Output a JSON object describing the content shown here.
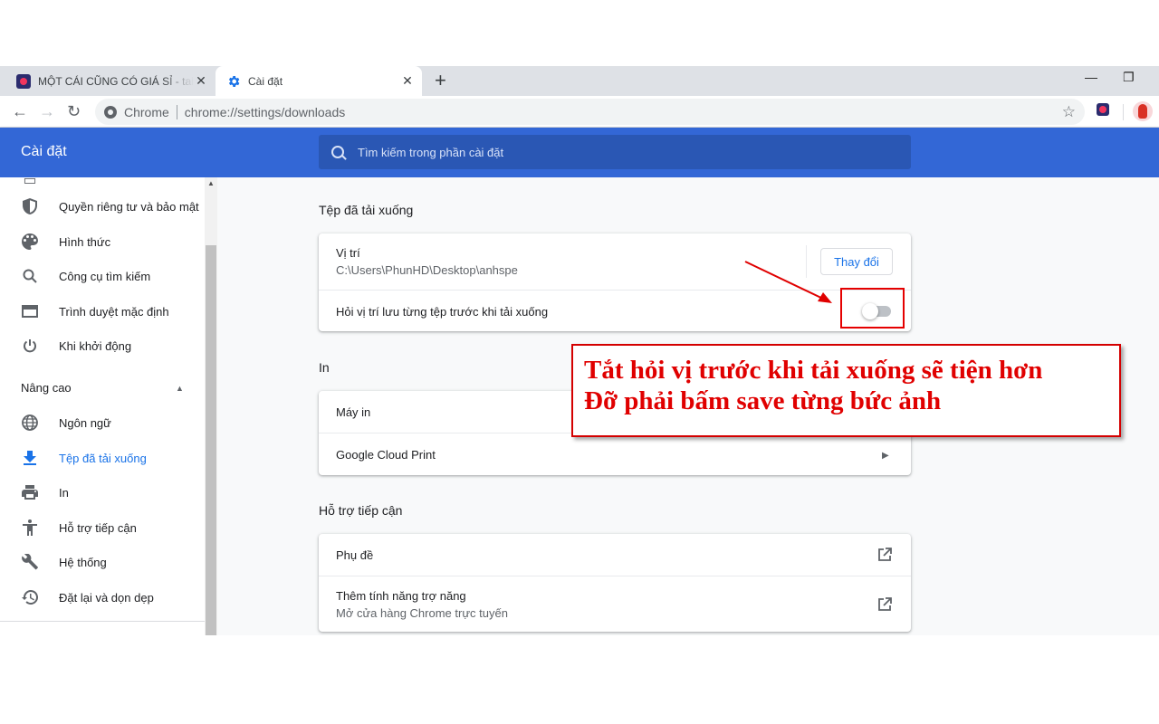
{
  "browser": {
    "tabs": [
      {
        "title": "MỘT CÁI CŨNG CÓ GIÁ SỈ - tai nghe",
        "close": "✕",
        "active": false
      },
      {
        "title": "Cài đặt",
        "close": "✕",
        "active": true
      }
    ],
    "new_tab": "+",
    "window_controls": {
      "minimize": "—",
      "restore": "❐"
    },
    "omnibox": {
      "chip": "Chrome",
      "url": "chrome://settings/downloads"
    },
    "icons": [
      "back-icon",
      "forward-icon",
      "reload-icon",
      "star-icon",
      "extension-icon",
      "profile-avatar"
    ]
  },
  "header": {
    "title": "Cài đặt",
    "search_placeholder": "Tìm kiếm trong phần cài đặt"
  },
  "sidebar": {
    "items": [
      {
        "label": "Quyền riêng tư và bảo mật",
        "icon": "shield-icon"
      },
      {
        "label": "Hình thức",
        "icon": "palette-icon"
      },
      {
        "label": "Công cụ tìm kiếm",
        "icon": "search-icon"
      },
      {
        "label": "Trình duyệt mặc định",
        "icon": "browser-window-icon"
      },
      {
        "label": "Khi khởi động",
        "icon": "power-icon"
      }
    ],
    "advanced_label": "Nâng cao",
    "advanced_items": [
      {
        "label": "Ngôn ngữ",
        "icon": "globe-icon"
      },
      {
        "label": "Tệp đã tải xuống",
        "icon": "download-icon",
        "active": true
      },
      {
        "label": "In",
        "icon": "printer-icon"
      },
      {
        "label": "Hỗ trợ tiếp cận",
        "icon": "accessibility-icon"
      },
      {
        "label": "Hệ thống",
        "icon": "wrench-icon"
      },
      {
        "label": "Đặt lại và dọn dẹp",
        "icon": "restore-icon"
      }
    ]
  },
  "downloads": {
    "section_title": "Tệp đã tải xuống",
    "location_label": "Vị trí",
    "location_value": "C:\\Users\\PhunHD\\Desktop\\anhspe",
    "change_button": "Thay đổi",
    "ask_label": "Hỏi vị trí lưu từng tệp trước khi tải xuống",
    "ask_enabled": false
  },
  "print": {
    "section_title": "In",
    "printers_label": "Máy in",
    "cloud_print_label": "Google Cloud Print"
  },
  "accessibility": {
    "section_title": "Hỗ trợ tiếp cận",
    "captions_label": "Phụ đề",
    "more_features_label": "Thêm tính năng trợ năng",
    "more_features_sub": "Mở cửa hàng Chrome trực tuyến"
  },
  "annotation": {
    "line1": "Tắt hỏi vị trước khi tải xuống sẽ tiện hơn",
    "line2": "Đỡ phải bấm save từng bức ảnh",
    "color": "#e00000"
  },
  "colors": {
    "accent": "#3367d6",
    "link": "#1a73e8"
  }
}
